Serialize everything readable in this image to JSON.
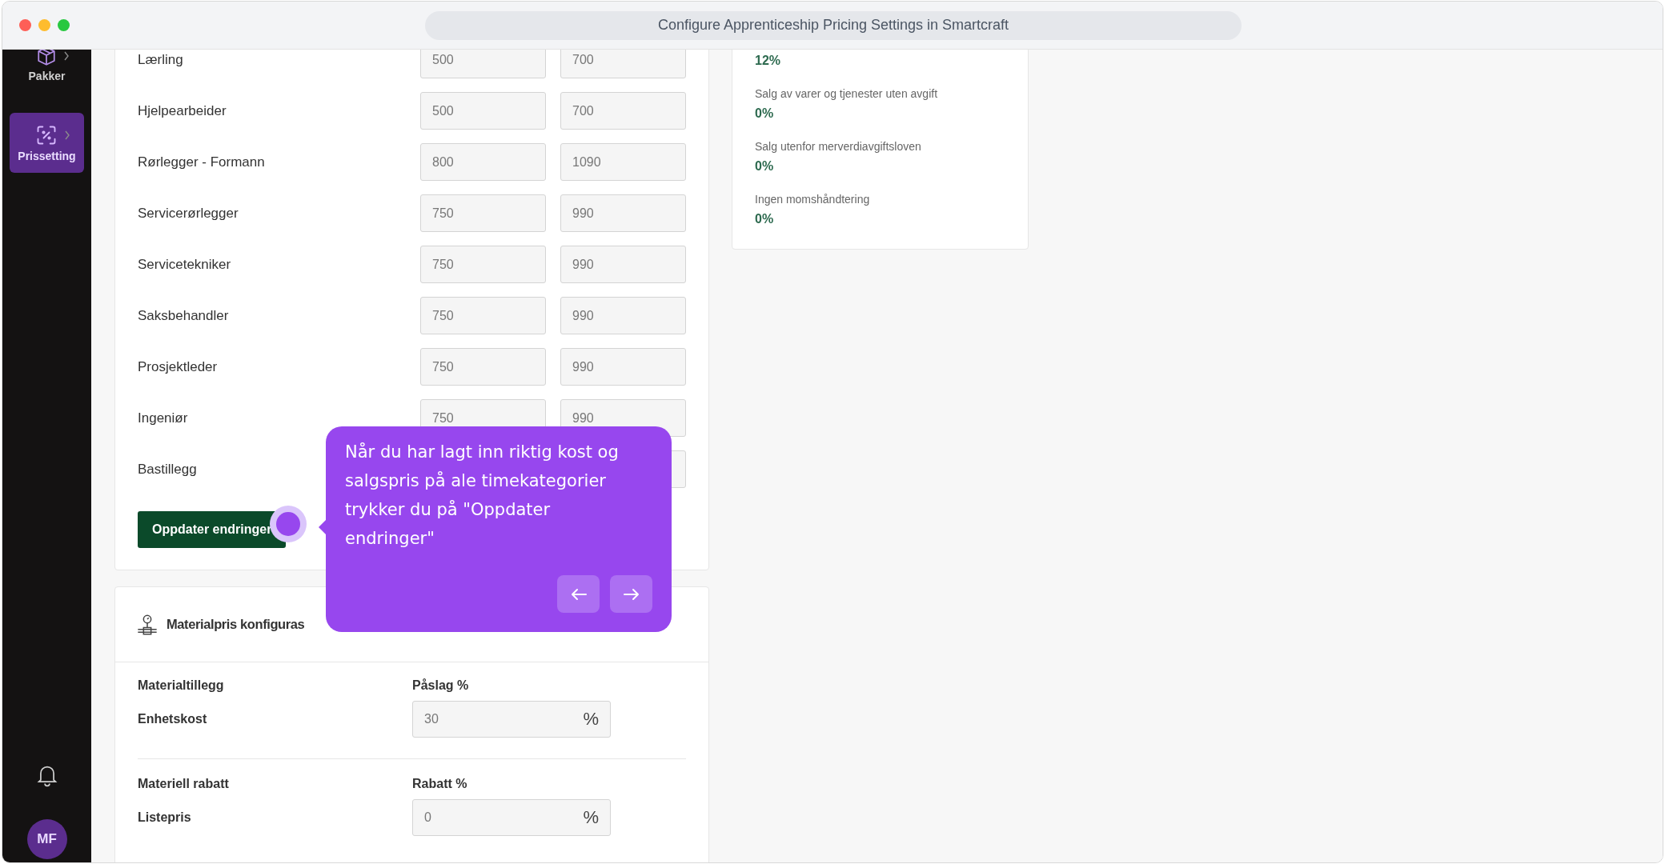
{
  "window": {
    "title": "Configure Apprenticeship Pricing Settings in Smartcraft"
  },
  "sidebar": {
    "items": [
      {
        "kind": "package",
        "label": "Pakker",
        "selected": false
      },
      {
        "kind": "pricing",
        "label": "Prissetting",
        "selected": true
      }
    ],
    "user": {
      "initials": "MF"
    }
  },
  "hourly_rates": {
    "rows": [
      {
        "label": "Lærling",
        "cost": "500",
        "price": "700"
      },
      {
        "label": "Hjelpearbeider",
        "cost": "500",
        "price": "700"
      },
      {
        "label": "Rørlegger - Formann",
        "cost": "800",
        "price": "1090"
      },
      {
        "label": "Servicerørlegger",
        "cost": "750",
        "price": "990"
      },
      {
        "label": "Servicetekniker",
        "cost": "750",
        "price": "990"
      },
      {
        "label": "Saksbehandler",
        "cost": "750",
        "price": "990"
      },
      {
        "label": "Prosjektleder",
        "cost": "750",
        "price": "990"
      },
      {
        "label": "Ingeniør",
        "cost": "750",
        "price": "990"
      },
      {
        "label": "Bastillegg"
      }
    ],
    "update_button": "Oppdater endringer"
  },
  "material_pricing": {
    "title": "Materialpris konfiguras",
    "sections": [
      {
        "heading": "Materialtillegg",
        "field_label": "Påslag %",
        "row_label": "Enhetskost",
        "value": "30",
        "unit": "%"
      },
      {
        "heading": "Materiell rabatt",
        "field_label": "Rabatt %",
        "row_label": "Listepris",
        "value": "0",
        "unit": "%"
      }
    ]
  },
  "vat_rates": {
    "items": [
      {
        "value": "12%"
      },
      {
        "label": "Salg av varer og tjenester uten avgift",
        "value": "0%"
      },
      {
        "label": "Salg utenfor merverdiavgiftsloven",
        "value": "0%"
      },
      {
        "label": "Ingen momshåndtering",
        "value": "0%"
      }
    ]
  },
  "tooltip": {
    "text": "Når du har lagt inn riktig kost og salgspris på ale timekategorier trykker du på \"Oppdater endringer\""
  }
}
